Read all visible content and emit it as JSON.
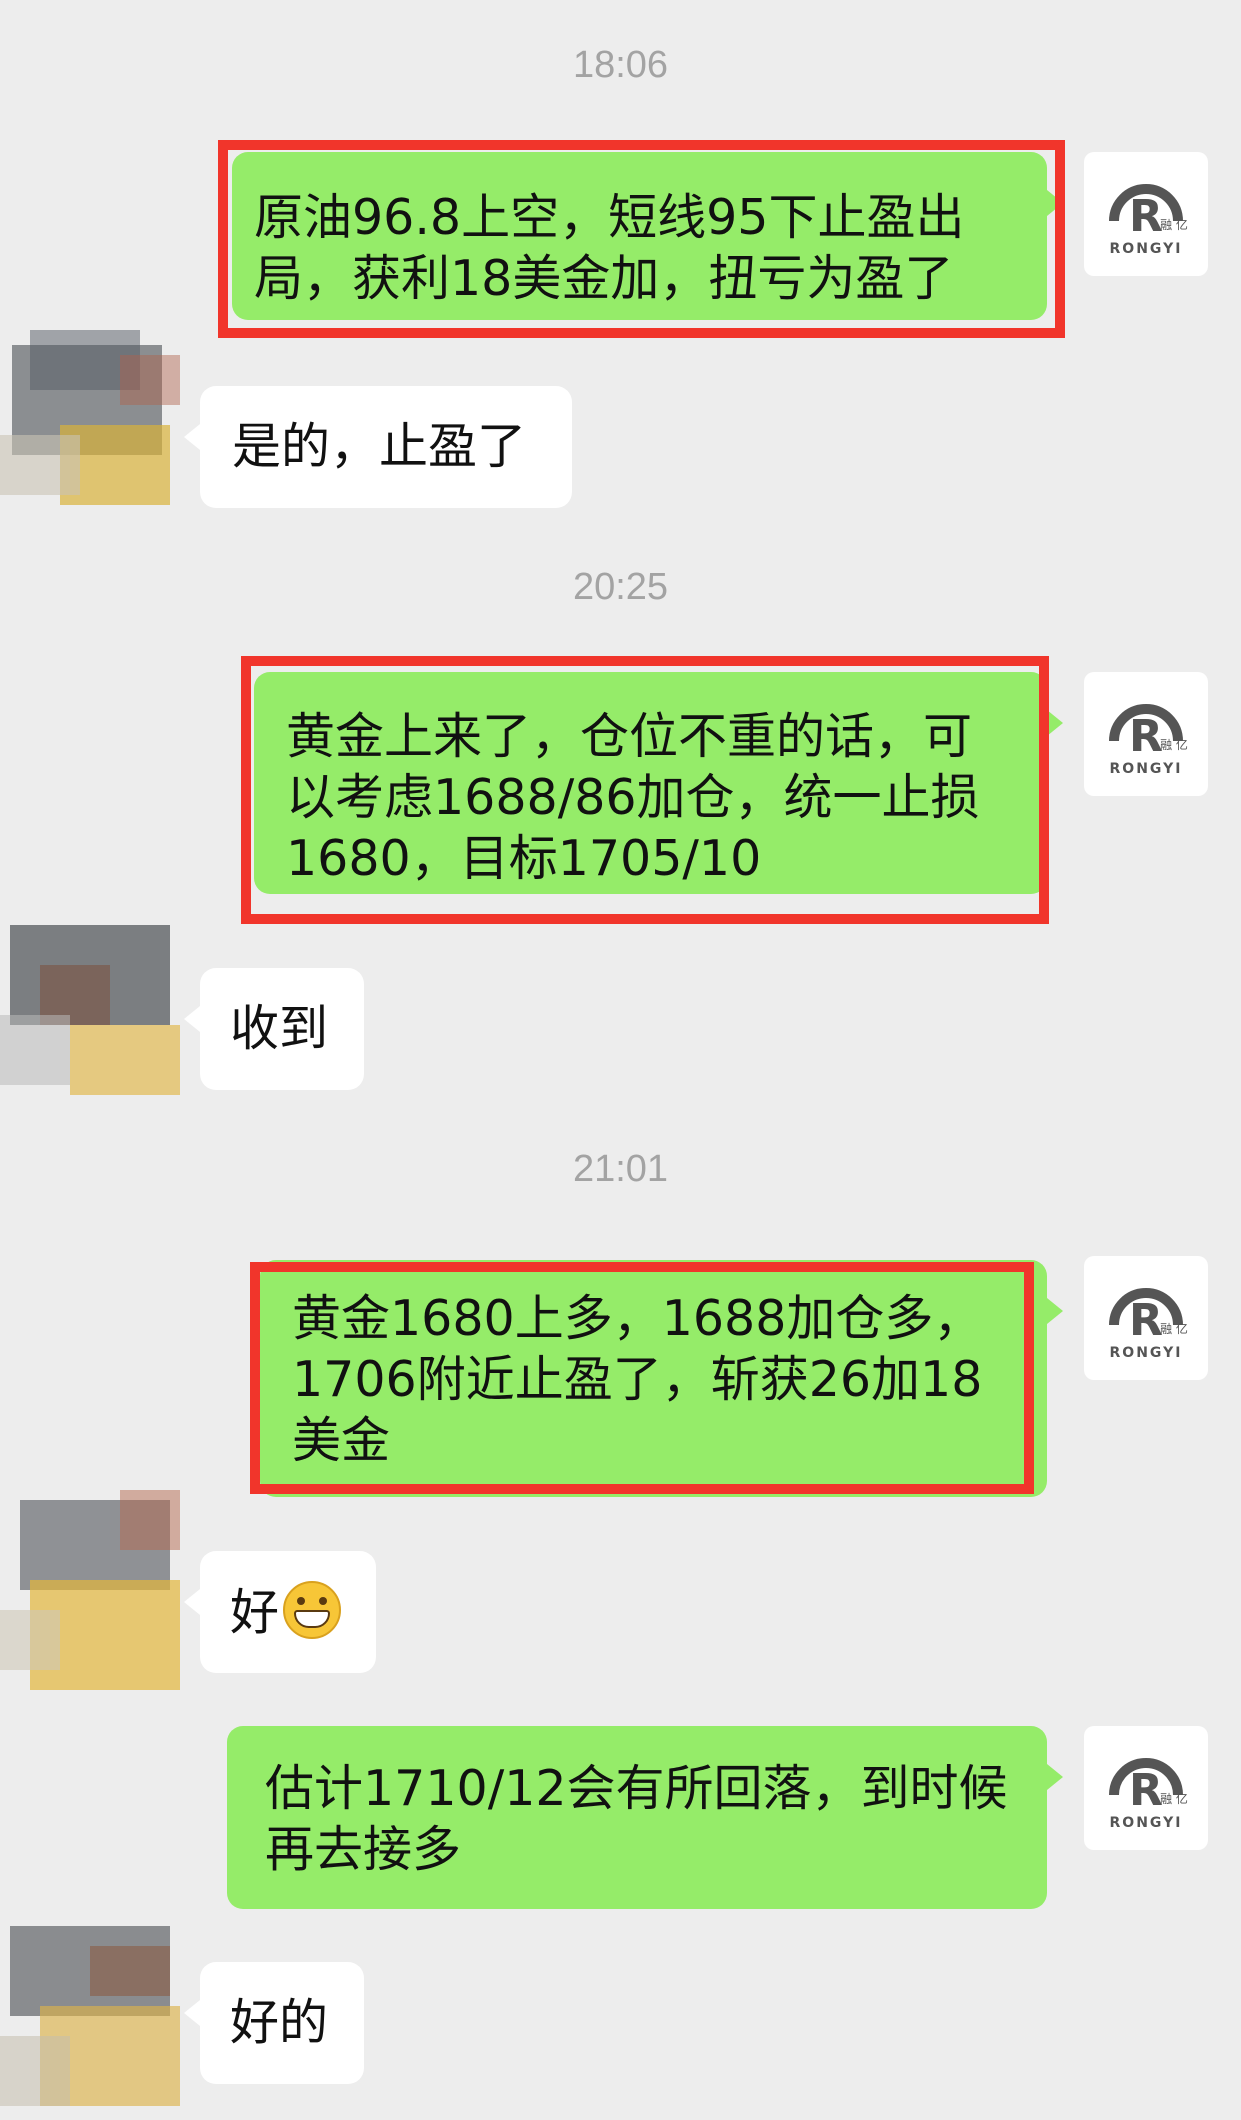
{
  "conversation": {
    "timestamps": [
      "18:06",
      "20:25",
      "21:01"
    ],
    "avatar_brand": {
      "mark": "R",
      "cn": "融 亿",
      "name": "RONGYI",
      "color": "#555555"
    },
    "messages": [
      {
        "from": "self",
        "text": "原油96.8上空，短线95下止盈出局，获利18美金加，扭亏为盈了",
        "highlighted": true
      },
      {
        "from": "other",
        "text": "是的，止盈了"
      },
      {
        "from": "self",
        "text": "黄金上来了，仓位不重的话，可以考虑1688/86加仓，统一止损1680，目标1705/10",
        "highlighted": true
      },
      {
        "from": "other",
        "text": "收到"
      },
      {
        "from": "self",
        "text": "黄金1680上多，1688加仓多，1706附近止盈了，斩获26加18美金",
        "highlighted": true
      },
      {
        "from": "other",
        "text": "好",
        "emoji": "grinning-face-emoji"
      },
      {
        "from": "self",
        "text": "估计1710/12会有所回落，到时候再去接多",
        "highlighted": false
      },
      {
        "from": "other",
        "text": "好的"
      }
    ]
  },
  "colors": {
    "self_bubble": "#95ec69",
    "other_bubble": "#ffffff",
    "highlight_border": "#f1352b",
    "background": "#ededed",
    "timestamp": "#a3a3a3"
  }
}
